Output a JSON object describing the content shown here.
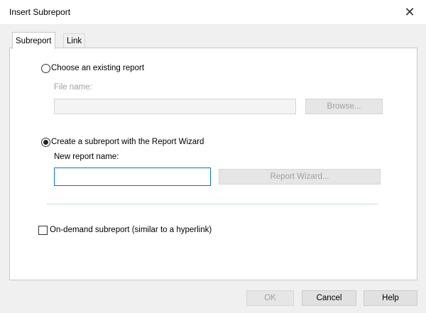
{
  "dialog": {
    "title": "Insert Subreport",
    "close_icon": "close-icon"
  },
  "tabs": [
    {
      "label": "Subreport",
      "active": true
    },
    {
      "label": "Link",
      "active": false
    }
  ],
  "existing": {
    "radio_label": "Choose an existing report",
    "checked": false,
    "file_name_label": "File name:",
    "file_name_value": "",
    "browse_label": "Browse..."
  },
  "wizard": {
    "radio_label": "Create a subreport with the Report Wizard",
    "checked": true,
    "new_name_label": "New report name:",
    "new_name_value": "",
    "wizard_button_label": "Report Wizard..."
  },
  "on_demand": {
    "label": "On-demand subreport (similar to a hyperlink)",
    "checked": false
  },
  "footer": {
    "ok_label": "OK",
    "cancel_label": "Cancel",
    "help_label": "Help"
  }
}
